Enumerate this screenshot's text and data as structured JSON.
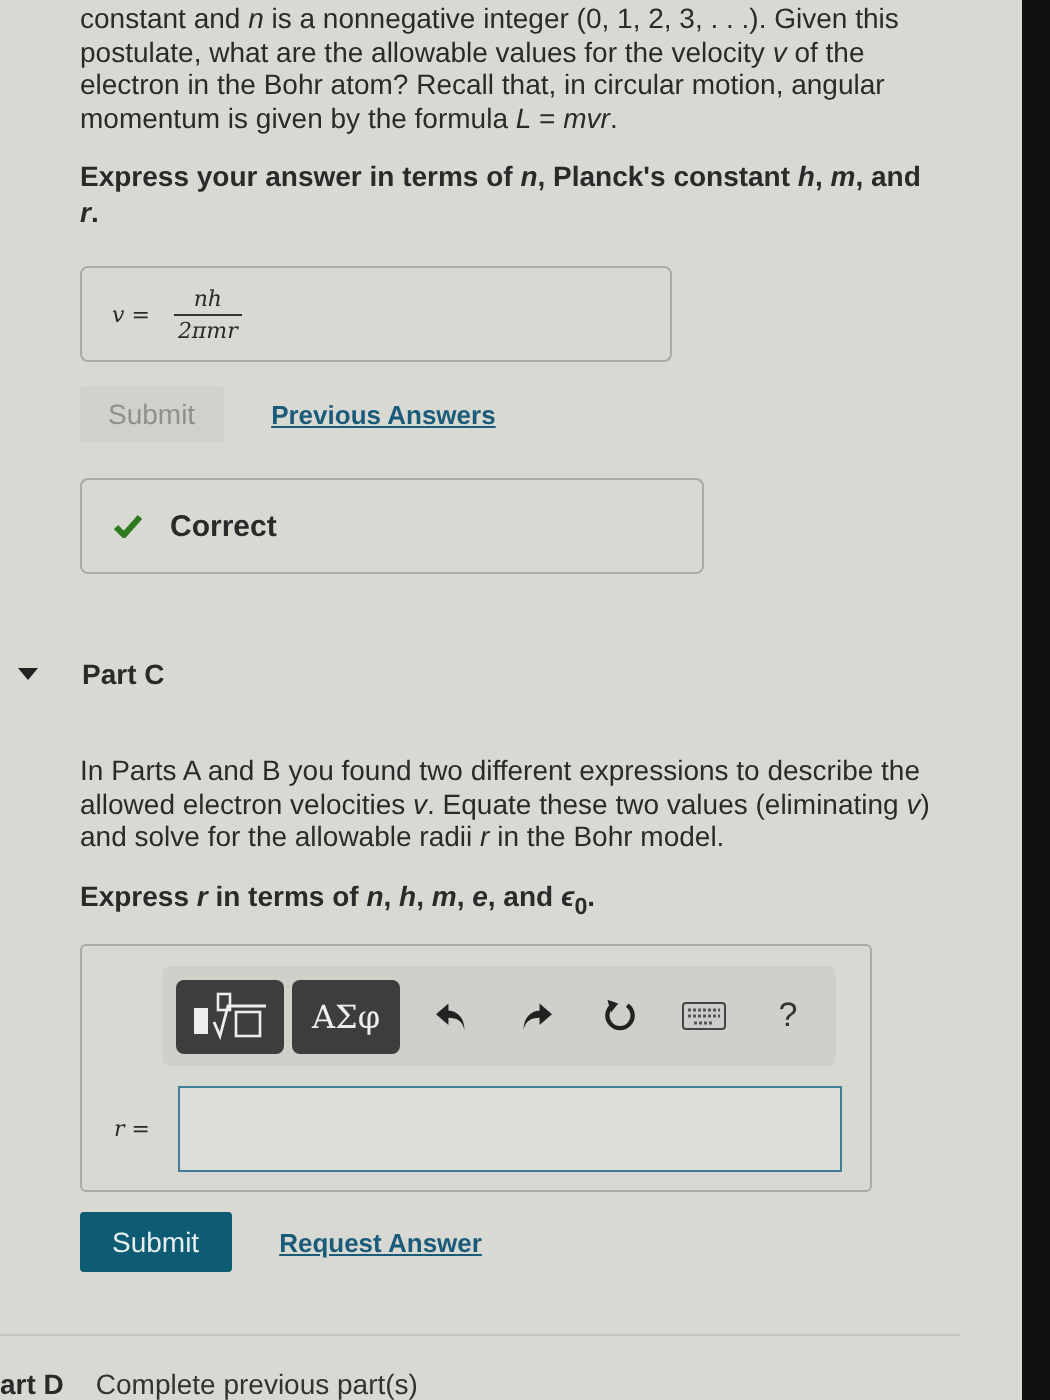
{
  "part_b": {
    "question": "constant and *n* is a nonnegative integer (0, 1, 2, 3, . . .). Given this postulate, what are the allowable values for the velocity *v* of the electron in the Bohr atom? Recall that, in circular motion, angular momentum is given by the formula *L* = *mvr*.",
    "instruction": "Express your answer in terms of *n*, Planck's constant *h*, *m*, and *r*.",
    "answer": {
      "label": "v =",
      "numerator": "nh",
      "denominator": "2πmr"
    },
    "submit": {
      "label": "Submit",
      "disabled": true
    },
    "link": "Previous Answers",
    "feedback": {
      "correct": true,
      "text": "Correct"
    }
  },
  "part_c": {
    "title": "Part C",
    "expanded": true,
    "question": "In Parts A and B you found two different expressions to describe the allowed electron velocities *v*. Equate these two values (eliminating *v*) and solve for the allowable radii *r* in the Bohr model.",
    "instruction": "Express *r* in terms of *n*, *h*, *m*, *e*, and *ϵ*$_{0}$.",
    "toolbar": [
      {
        "kind": "templates"
      },
      {
        "kind": "greek",
        "label": "ΑΣφ"
      },
      {
        "kind": "undo"
      },
      {
        "kind": "redo"
      },
      {
        "kind": "reset"
      },
      {
        "kind": "keyboard"
      },
      {
        "kind": "help",
        "label": "?"
      }
    ],
    "answer": {
      "label": "r ="
    },
    "submit": {
      "label": "Submit",
      "disabled": false
    },
    "link": "Request Answer"
  },
  "part_d": {
    "title": "art D",
    "status": "Complete previous part(s)"
  }
}
